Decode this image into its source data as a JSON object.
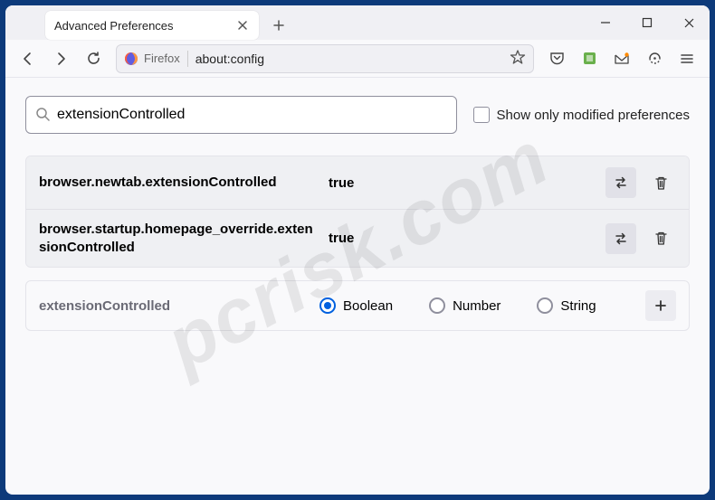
{
  "window": {
    "tab_title": "Advanced Preferences"
  },
  "urlbar": {
    "identity_label": "Firefox",
    "url": "about:config"
  },
  "search": {
    "value": "extensionControlled",
    "show_modified_label": "Show only modified preferences"
  },
  "prefs": [
    {
      "name": "browser.newtab.extensionControlled",
      "value": "true"
    },
    {
      "name": "browser.startup.homepage_override.extensionControlled",
      "value": "true"
    }
  ],
  "new_pref": {
    "name": "extensionControlled",
    "types": {
      "boolean": "Boolean",
      "number": "Number",
      "string": "String"
    }
  },
  "watermark": "pcrisk.com"
}
